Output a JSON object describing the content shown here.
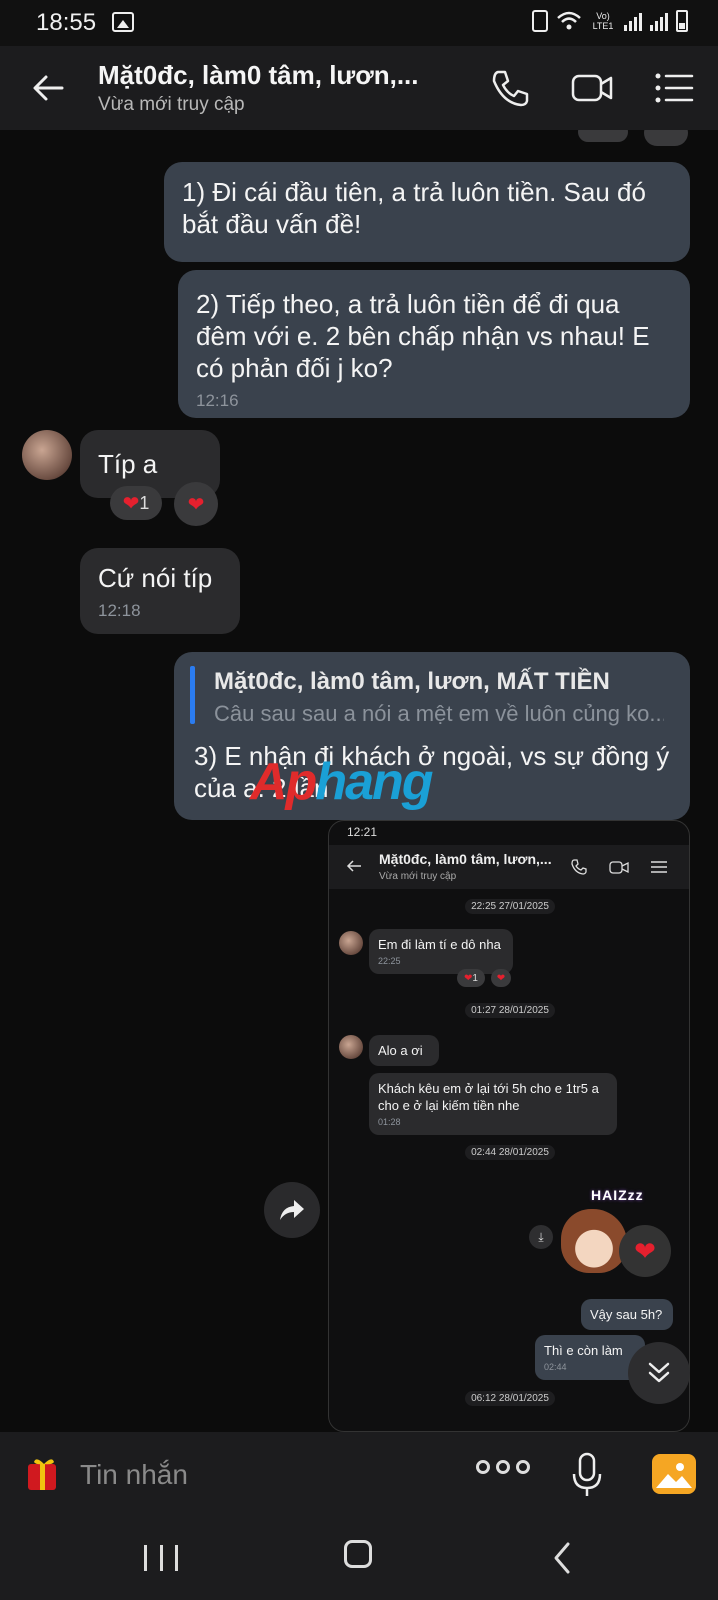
{
  "status_bar": {
    "time": "18:55",
    "network_label": "Vo) LTE1"
  },
  "header": {
    "title": "Mặt0đc, làm0 tâm, lươn,...",
    "status": "Vừa mới truy cập"
  },
  "messages": {
    "m1": {
      "text": "1) Đi cái đầu tiên, a trả luôn tiền. Sau đó bắt đầu vấn đề!"
    },
    "m2": {
      "text": "2) Tiếp theo, a trả luôn tiền để đi qua đêm với e. 2 bên chấp nhận vs nhau! E có phản đối j ko?",
      "time": "12:16"
    },
    "m3": {
      "text": "Típ a",
      "reaction_count": "1"
    },
    "m4": {
      "text": "Cứ  nói típ",
      "time": "12:18"
    },
    "m5": {
      "quote_name": "Mặt0đc, làm0 tâm, lươn, MẤT TIỀN",
      "quote_text": "Câu sau sau a nói a mệt em về luôn củng ko...",
      "text": "3) E nhận đi khách ở ngoài, vs sự đồng ý của a. 2 lần"
    }
  },
  "watermark": {
    "part1": "Ap",
    "part2": "hang"
  },
  "screenshot": {
    "time": "12:21",
    "title": "Mặt0đc, làm0 tâm, lươn,...",
    "status": "Vừa mới truy cập",
    "date1": "22:25 27/01/2025",
    "msg1": {
      "text": "Em đi làm tí e dô nha",
      "time": "22:25",
      "reaction_count": "1"
    },
    "date2": "01:27 28/01/2025",
    "msg2": {
      "text": "Alo a ơi"
    },
    "msg3": {
      "text": "Khách kêu em ở lại tới 5h cho e 1tr5 a cho e ở lại kiếm tiền nhe",
      "time": "01:28"
    },
    "date3": "02:44 28/01/2025",
    "sticker_text": "HAIZzz",
    "msg4": {
      "text": "Vậy sau 5h?"
    },
    "msg5": {
      "text": "Thì e còn làm",
      "time": "02:44"
    },
    "date4": "06:12 28/01/2025"
  },
  "composer": {
    "placeholder": "Tin nhắn"
  },
  "colors": {
    "outgoing_bubble": "#3a424d",
    "incoming_bubble": "#2b2b2d",
    "quote_accent": "#2b7cf0",
    "reaction_heart": "#e5202e"
  },
  "icons": [
    "back-arrow-icon",
    "phone-icon",
    "video-icon",
    "menu-icon",
    "forward-icon",
    "chevron-double-down-icon",
    "gift-icon",
    "more-icon",
    "mic-icon",
    "gallery-icon"
  ]
}
